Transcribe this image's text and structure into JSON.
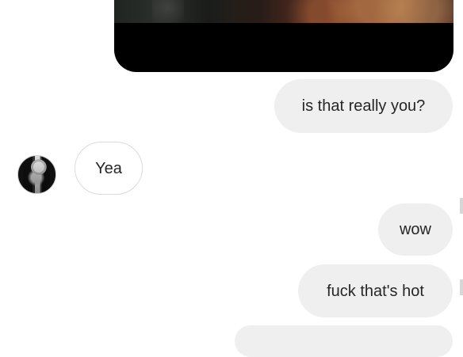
{
  "conversation": {
    "messages": [
      {
        "side": "outgoing",
        "text": "is that really you?"
      },
      {
        "side": "incoming",
        "text": "Yea"
      },
      {
        "side": "outgoing",
        "text": "wow"
      },
      {
        "side": "outgoing",
        "text": "fuck that's hot"
      }
    ]
  },
  "colors": {
    "outgoing_bubble": "#efefef",
    "incoming_bubble_border": "#dbdbdb",
    "text": "#262626",
    "background": "#ffffff"
  },
  "icons": {
    "avatar": "profile-avatar"
  }
}
